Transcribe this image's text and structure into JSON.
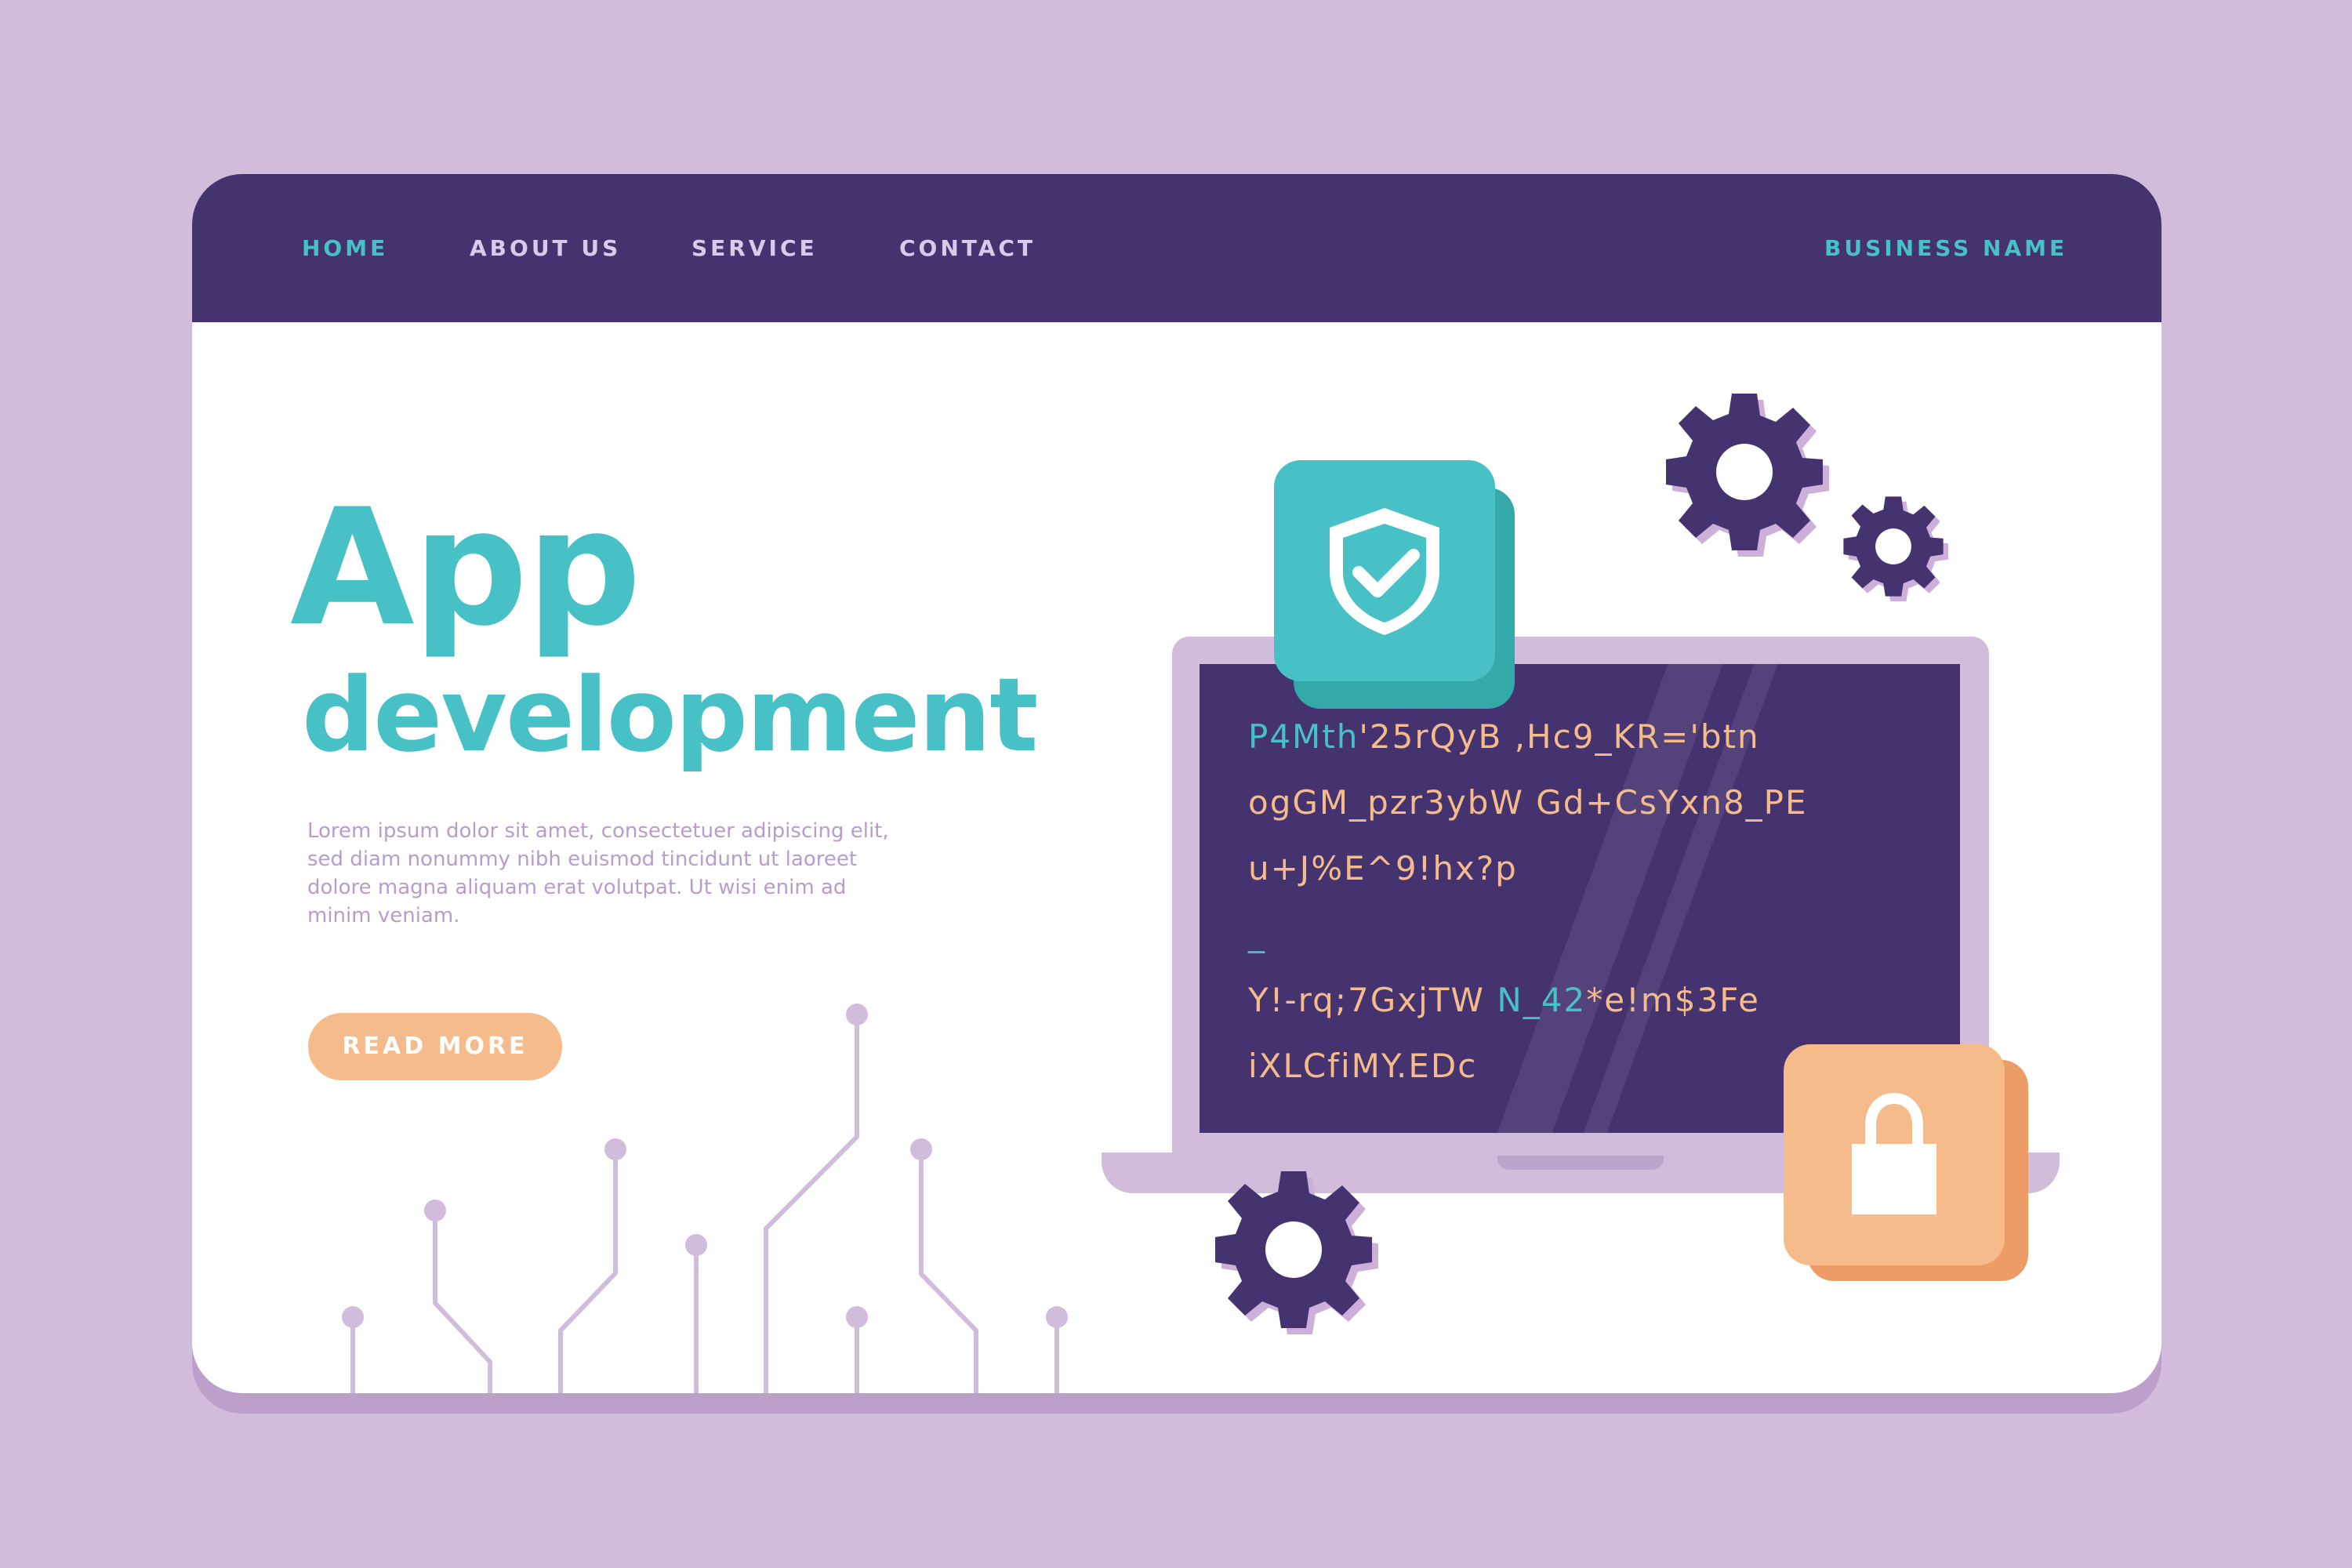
{
  "nav": {
    "home": "HOME",
    "about": "ABOUT US",
    "service": "SERVICE",
    "contact": "CONTACT",
    "brand": "BUSINESS NAME"
  },
  "hero": {
    "title_line1": "App",
    "title_line2": "development",
    "body_lines": [
      "Lorem ipsum dolor sit amet, consectetuer adipiscing elit,",
      "sed diam nonummy nibh euismod tincidunt ut laoreet",
      "dolore magna aliquam erat volutpat. Ut wisi enim ad",
      "minim veniam."
    ],
    "button_label": "READ MORE"
  },
  "screen": {
    "code_lines": [
      {
        "teal": "P4Mth",
        "rest": "'25rQyB ,Hc9_KR='btn"
      },
      {
        "teal": "",
        "rest": "ogGM_pzr3ybW Gd+CsYxn8_PE"
      },
      {
        "teal": "",
        "rest": "u+J%E^9!hx?p"
      },
      {
        "teal": "_",
        "rest": ""
      },
      {
        "teal": "",
        "rest": "Y!-rq;7GxjTW ",
        "teal2": "N_42",
        "rest2": "*e!m$3Fe"
      },
      {
        "teal": "",
        "rest": "iXLCfiMY.EDc"
      }
    ]
  },
  "icons": {
    "shield": "shield-check-icon",
    "lock": "padlock-icon",
    "gear": "gear-icon"
  },
  "colors": {
    "background": "#d2bcdc",
    "navbar": "#45336f",
    "accent_teal": "#47c1c6",
    "accent_orange": "#f5bb8b",
    "lavender": "#d2bcdc",
    "body_text": "#b79ccc"
  }
}
